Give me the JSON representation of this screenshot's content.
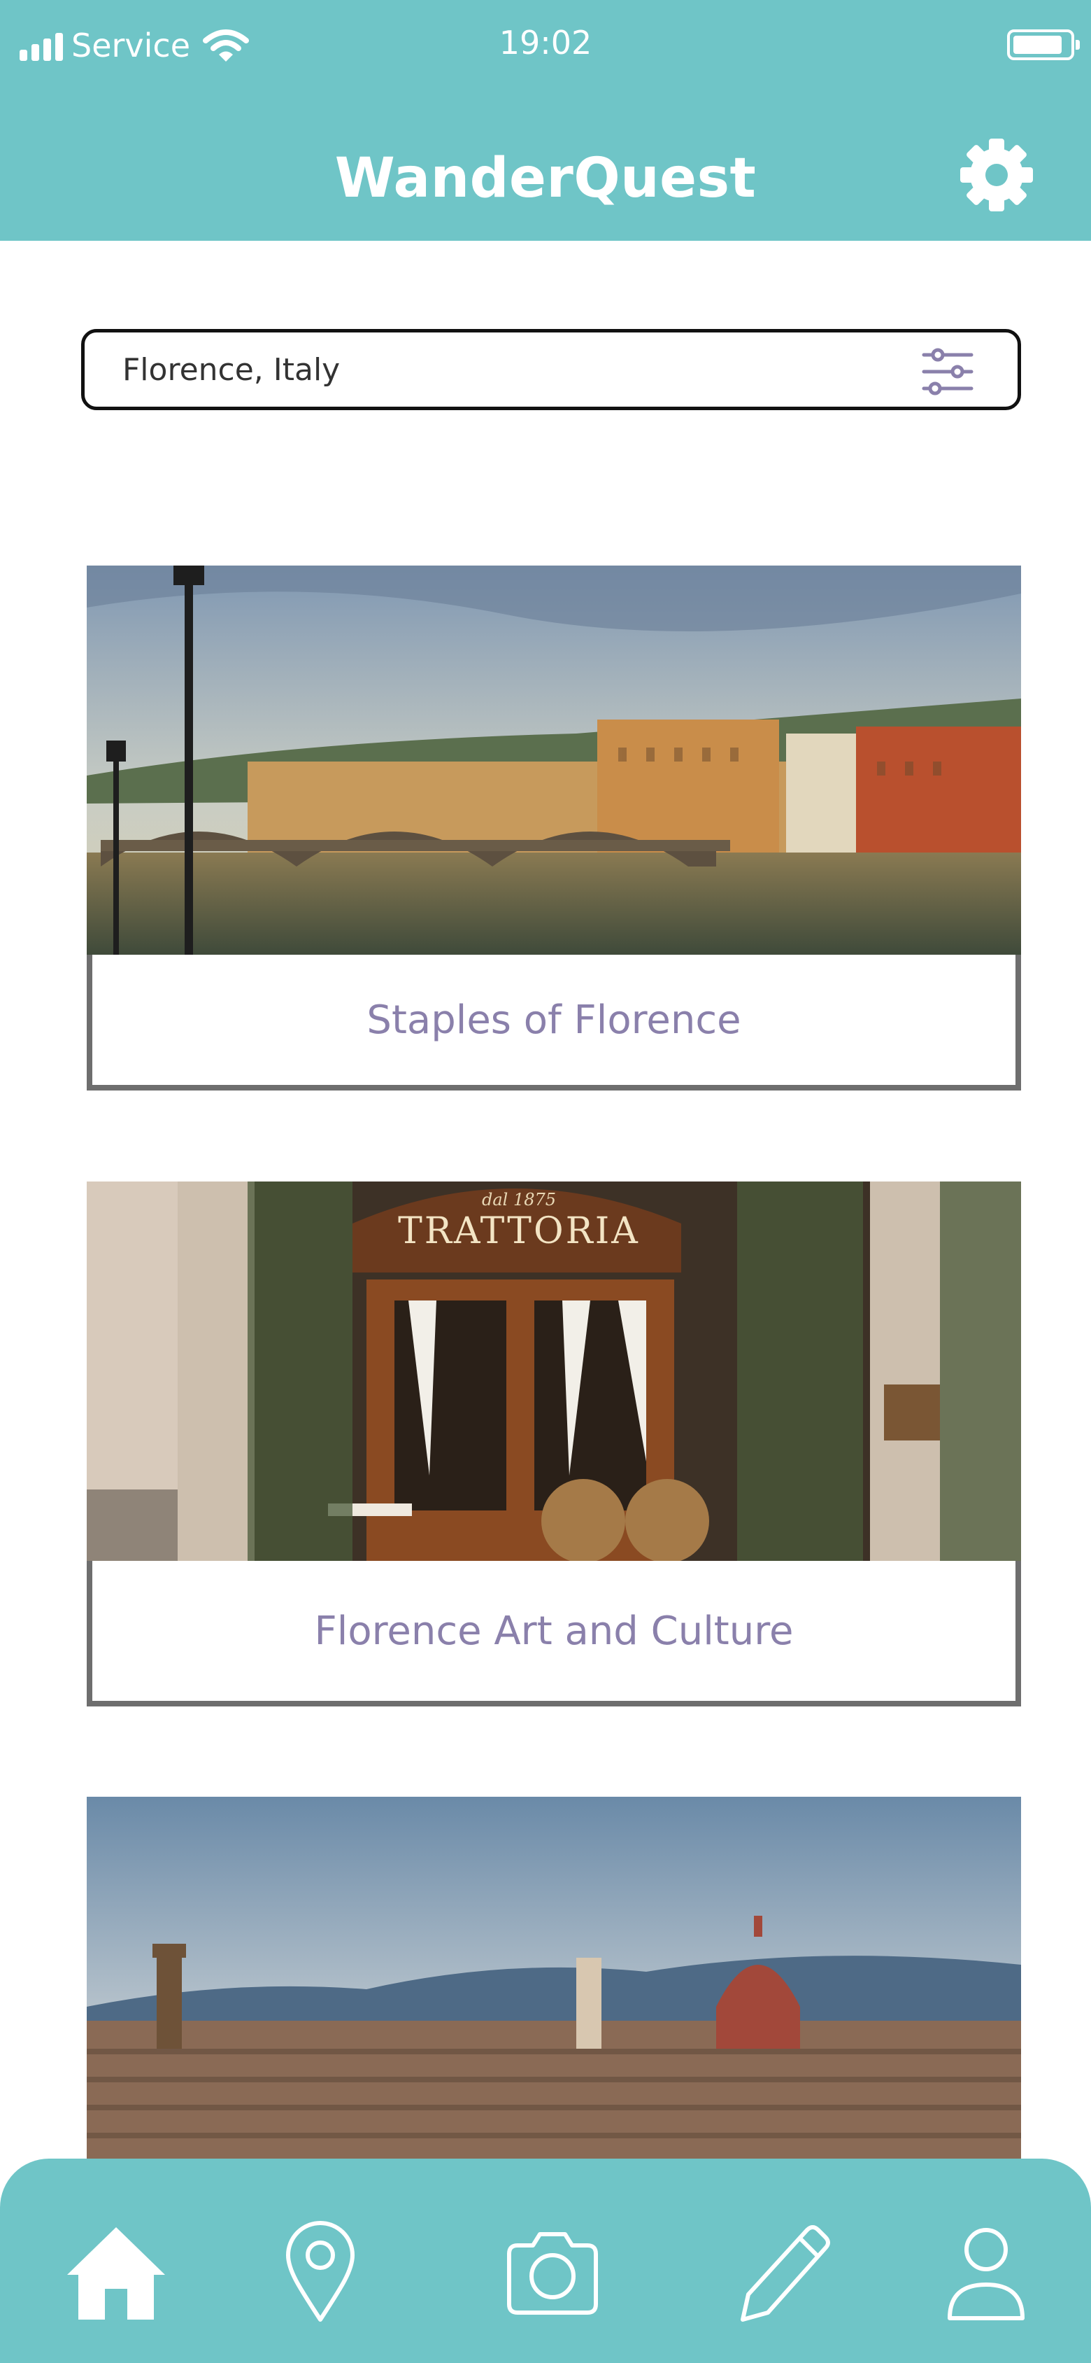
{
  "status_bar": {
    "carrier": "Service",
    "time": "19:02",
    "battery_percent": 85
  },
  "header": {
    "title": "WanderQuest",
    "icon": "gear-icon"
  },
  "search": {
    "value": "Florence, Italy",
    "icon": "filter-sliders-icon"
  },
  "cards": [
    {
      "title": "Staples of Florence",
      "photo": "ponte-santa-trinita-arno-river"
    },
    {
      "title": "Florence Art and Culture",
      "photo": "trattoria-storefront",
      "sign_text": "TRATTORIA",
      "sign_small": "dal 1875"
    },
    {
      "title": "",
      "photo": "florence-skyline-duomo"
    }
  ],
  "tab_bar": {
    "active": "home",
    "items": [
      {
        "name": "home",
        "icon": "home-icon"
      },
      {
        "name": "map",
        "icon": "map-pin-icon"
      },
      {
        "name": "camera",
        "icon": "camera-icon"
      },
      {
        "name": "journal",
        "icon": "pencil-icon"
      },
      {
        "name": "profile",
        "icon": "user-icon"
      }
    ]
  },
  "colors": {
    "brand": "#6fc5c7",
    "card_title": "#8a80ab",
    "card_border": "#6e6e6e"
  }
}
